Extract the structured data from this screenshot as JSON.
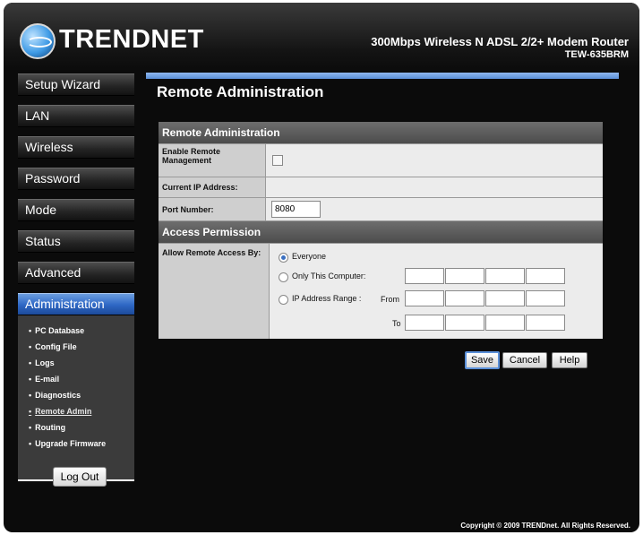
{
  "header": {
    "brand": "TRENDNET",
    "product": "300Mbps Wireless N ADSL 2/2+ Modem Router",
    "model": "TEW-635BRM"
  },
  "sidebar": {
    "items": [
      {
        "label": "Setup Wizard"
      },
      {
        "label": "LAN"
      },
      {
        "label": "Wireless"
      },
      {
        "label": "Password"
      },
      {
        "label": "Mode"
      },
      {
        "label": "Status"
      },
      {
        "label": "Advanced"
      },
      {
        "label": "Administration"
      }
    ],
    "submenu": [
      {
        "label": "PC Database"
      },
      {
        "label": "Config File"
      },
      {
        "label": "Logs"
      },
      {
        "label": "E-mail"
      },
      {
        "label": "Diagnostics"
      },
      {
        "label": "Remote Admin"
      },
      {
        "label": "Routing"
      },
      {
        "label": "Upgrade Firmware"
      }
    ],
    "logout": "Log Out"
  },
  "main": {
    "title": "Remote Administration",
    "section1": "Remote Administration",
    "enable_label": "Enable Remote Management",
    "current_ip_label": "Current IP Address:",
    "port_label": "Port Number:",
    "port_value": "8080",
    "section2": "Access Permission",
    "allow_label": "Allow Remote Access By:",
    "opt_everyone": "Everyone",
    "opt_only": "Only This Computer:",
    "opt_range": "IP Address Range :",
    "from_label": "From",
    "to_label": "To",
    "buttons": {
      "save": "Save",
      "cancel": "Cancel",
      "help": "Help"
    }
  },
  "footer": "Copyright © 2009 TRENDnet. All Rights Reserved."
}
